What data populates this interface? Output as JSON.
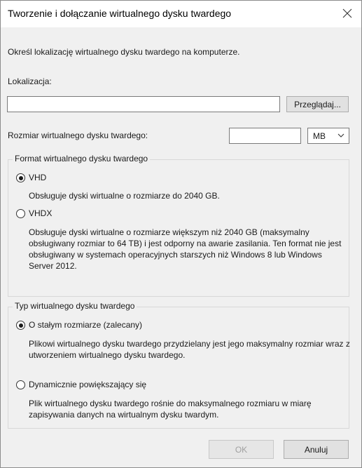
{
  "dialog": {
    "title": "Tworzenie i dołączanie wirtualnego dysku twardego",
    "intro": "Określ lokalizację wirtualnego dysku twardego na komputerze.",
    "location": {
      "label": "Lokalizacja:",
      "value": "",
      "browse_label": "Przeglądaj..."
    },
    "size": {
      "label": "Rozmiar wirtualnego dysku twardego:",
      "value": "",
      "unit": "MB"
    },
    "format_group": {
      "legend": "Format wirtualnego dysku twardego",
      "options": [
        {
          "label": "VHD",
          "checked": true,
          "description": "Obsługuje dyski wirtualne o rozmiarze do 2040 GB."
        },
        {
          "label": "VHDX",
          "checked": false,
          "description": "Obsługuje dyski wirtualne o rozmiarze większym niż 2040 GB (maksymalny obsługiwany rozmiar to 64 TB) i jest odporny na awarie zasilania. Ten format nie jest obsługiwany w systemach operacyjnych starszych niż Windows 8 lub Windows Server 2012."
        }
      ]
    },
    "type_group": {
      "legend": "Typ wirtualnego dysku twardego",
      "options": [
        {
          "label": "O stałym rozmiarze (zalecany)",
          "checked": true,
          "description": "Plikowi wirtualnego dysku twardego przydzielany jest jego maksymalny rozmiar wraz z utworzeniem wirtualnego dysku twardego."
        },
        {
          "label": "Dynamicznie powiększający się",
          "checked": false,
          "description": "Plik wirtualnego dysku twardego rośnie do maksymalnego rozmiaru w miarę zapisywania danych na wirtualnym dysku twardym."
        }
      ]
    },
    "buttons": {
      "ok": "OK",
      "cancel": "Anuluj"
    }
  }
}
